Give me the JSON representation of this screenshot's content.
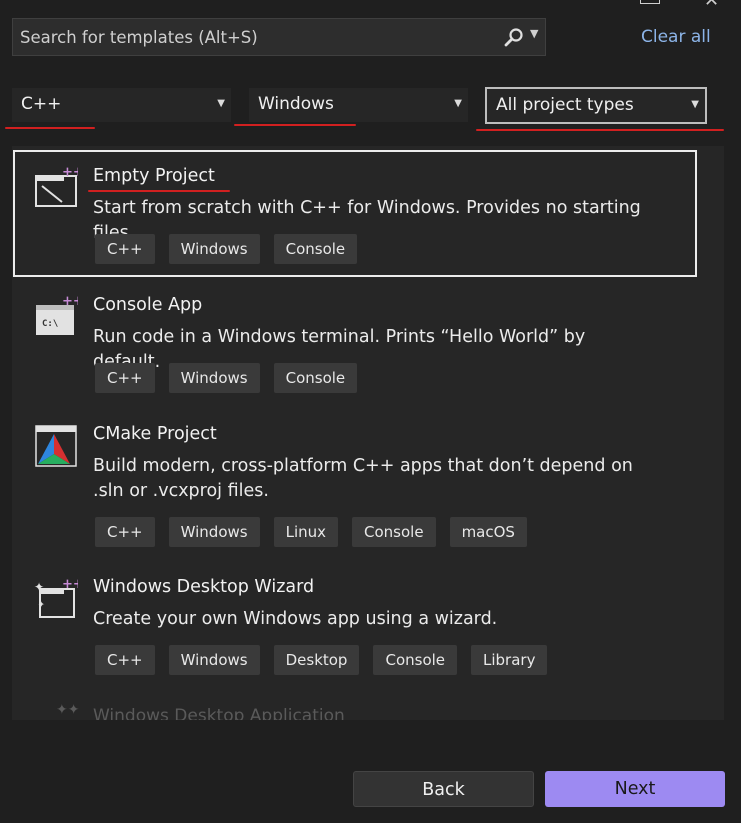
{
  "search": {
    "placeholder": "Search for templates (Alt+S)",
    "icon": "search-icon"
  },
  "clear_all_label": "Clear all",
  "filters": {
    "language": "C++",
    "platform": "Windows",
    "project_type": "All project types"
  },
  "templates": [
    {
      "title": "Empty Project",
      "description": "Start from scratch with C++ for Windows. Provides no starting files.",
      "tags": [
        "C++",
        "Windows",
        "Console"
      ],
      "selected": true,
      "icon": "empty-project-icon"
    },
    {
      "title": "Console App",
      "description": "Run code in a Windows terminal. Prints “Hello World” by default.",
      "tags": [
        "C++",
        "Windows",
        "Console"
      ],
      "icon": "console-app-icon"
    },
    {
      "title": "CMake Project",
      "description": "Build modern, cross-platform C++ apps that don’t depend on .sln or .vcxproj files.",
      "tags": [
        "C++",
        "Windows",
        "Linux",
        "Console",
        "macOS"
      ],
      "icon": "cmake-icon"
    },
    {
      "title": "Windows Desktop Wizard",
      "description": "Create your own Windows app using a wizard.",
      "tags": [
        "C++",
        "Windows",
        "Desktop",
        "Console",
        "Library"
      ],
      "icon": "wizard-icon"
    }
  ],
  "next_template_partial": "Windows Desktop Application",
  "buttons": {
    "back": "Back",
    "next": "Next"
  },
  "colors": {
    "accent": "#9d8af2",
    "link": "#8cb4e8",
    "annotation": "#d12020"
  }
}
